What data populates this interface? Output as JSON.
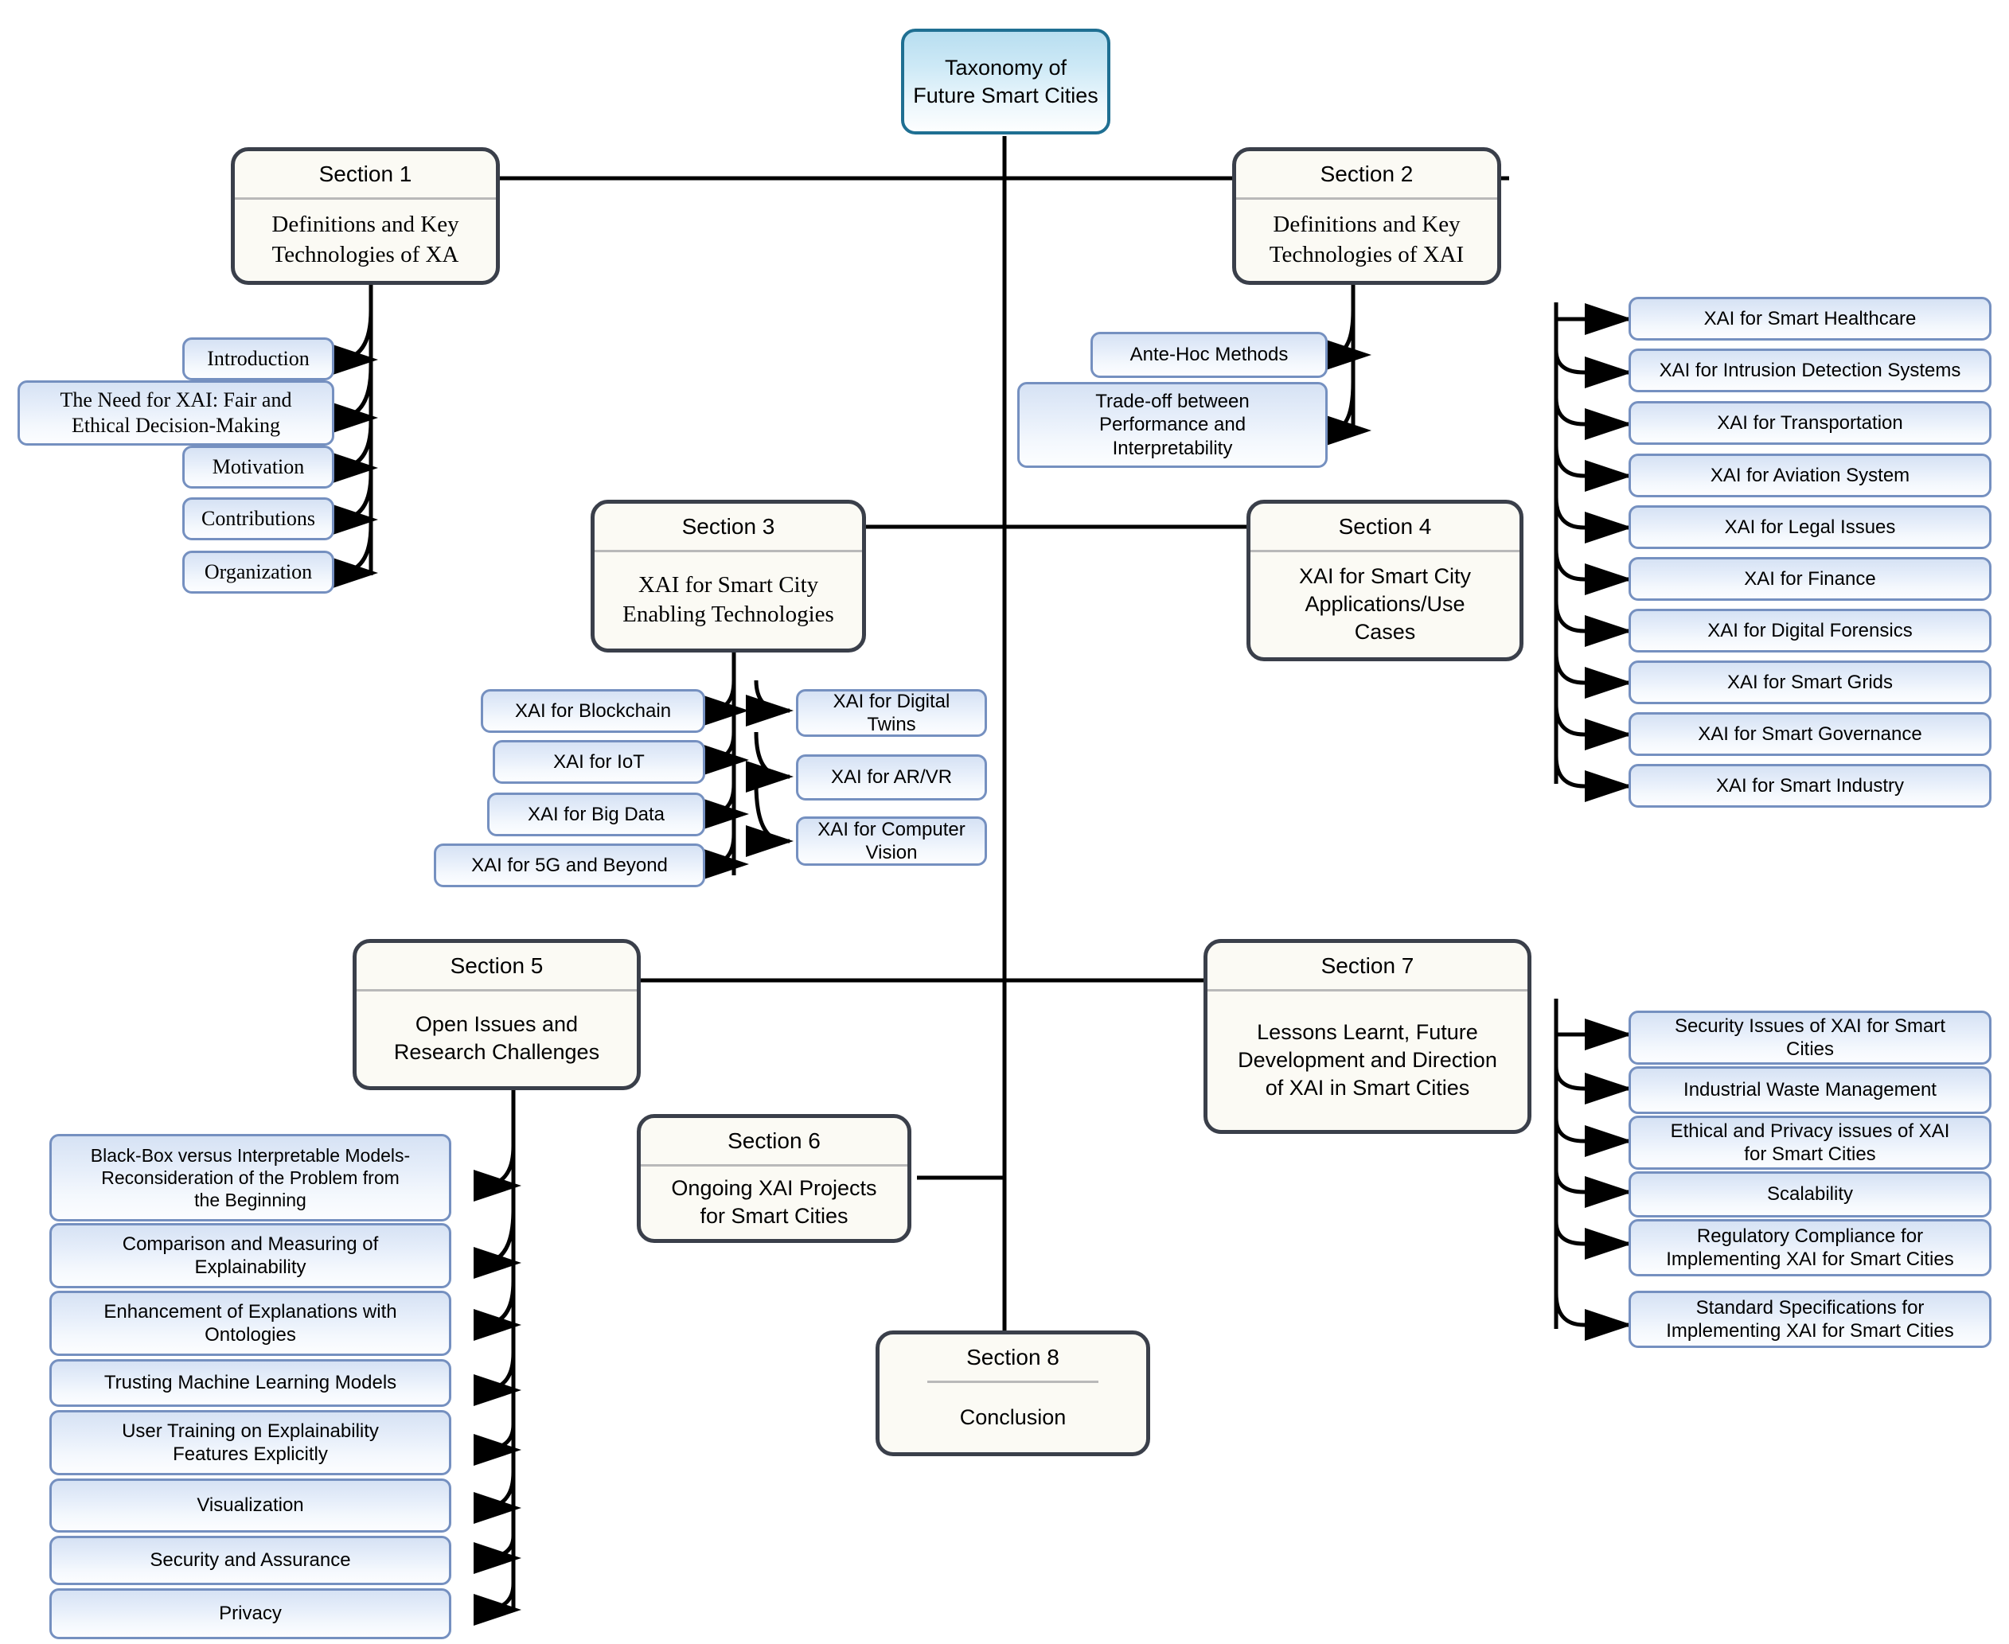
{
  "diagram": {
    "title": "Taxonomy of Future Smart Cities",
    "root": {
      "label": "Taxonomy of\nFuture Smart Cities"
    },
    "colors": {
      "root_border": "#1f6f92",
      "root_fill_top": "#b8def0",
      "section_border": "#3a3f4a",
      "section_fill": "#fbfaf4",
      "leaf_border": "#7590c0",
      "leaf_fill_top": "#d6e2f4",
      "connector": "#000000"
    },
    "sections": [
      {
        "id": "section-1",
        "title": "Section 1",
        "body": "Definitions and Key\nTechnologies of XA",
        "children": [
          "Introduction",
          "The Need for XAI: Fair and\nEthical Decision-Making",
          "Motivation",
          "Contributions",
          "Organization"
        ]
      },
      {
        "id": "section-2",
        "title": "Section 2",
        "body": "Definitions and Key\nTechnologies of XAI",
        "children": [
          "Ante-Hoc Methods",
          "Trade-off between\nPerformance and\nInterpretability"
        ]
      },
      {
        "id": "section-3",
        "title": "Section 3",
        "body": "XAI for Smart City\nEnabling Technologies",
        "children_left": [
          "XAI for Blockchain",
          "XAI for IoT",
          "XAI for Big Data",
          "XAI for 5G and Beyond"
        ],
        "children_right": [
          "XAI for Digital\nTwins",
          "XAI for AR/VR",
          "XAI for Computer\nVision"
        ]
      },
      {
        "id": "section-4",
        "title": "Section 4",
        "body": "XAI for Smart City\nApplications/Use\nCases",
        "children": [
          "XAI for Smart Healthcare",
          "XAI for Intrusion Detection Systems",
          "XAI for Transportation",
          "XAI for Aviation System",
          "XAI for Legal Issues",
          "XAI for Finance",
          "XAI for Digital Forensics",
          "XAI for Smart Grids",
          "XAI for Smart Governance",
          "XAI for Smart Industry"
        ]
      },
      {
        "id": "section-5",
        "title": "Section 5",
        "body": "Open Issues and\nResearch Challenges",
        "children": [
          "Black-Box versus Interpretable Models-\nReconsideration of the Problem from\nthe Beginning",
          "Comparison and Measuring of\nExplainability",
          "Enhancement of Explanations with\nOntologies",
          "Trusting Machine Learning Models",
          "User Training on Explainability\nFeatures Explicitly",
          "Visualization",
          "Security and Assurance",
          "Privacy"
        ]
      },
      {
        "id": "section-6",
        "title": "Section 6",
        "body": "Ongoing XAI Projects\nfor Smart Cities",
        "children": []
      },
      {
        "id": "section-7",
        "title": "Section 7",
        "body": "Lessons Learnt, Future\nDevelopment and Direction\nof XAI in Smart Cities",
        "children": [
          "Security Issues of XAI for Smart\nCities",
          "Industrial Waste Management",
          "Ethical and Privacy issues of XAI\nfor Smart Cities",
          "Scalability",
          "Regulatory Compliance for\nImplementing XAI for Smart Cities",
          "Standard Specifications for\nImplementing XAI for Smart Cities"
        ]
      },
      {
        "id": "section-8",
        "title": "Section 8",
        "body": "Conclusion",
        "children": []
      }
    ]
  }
}
